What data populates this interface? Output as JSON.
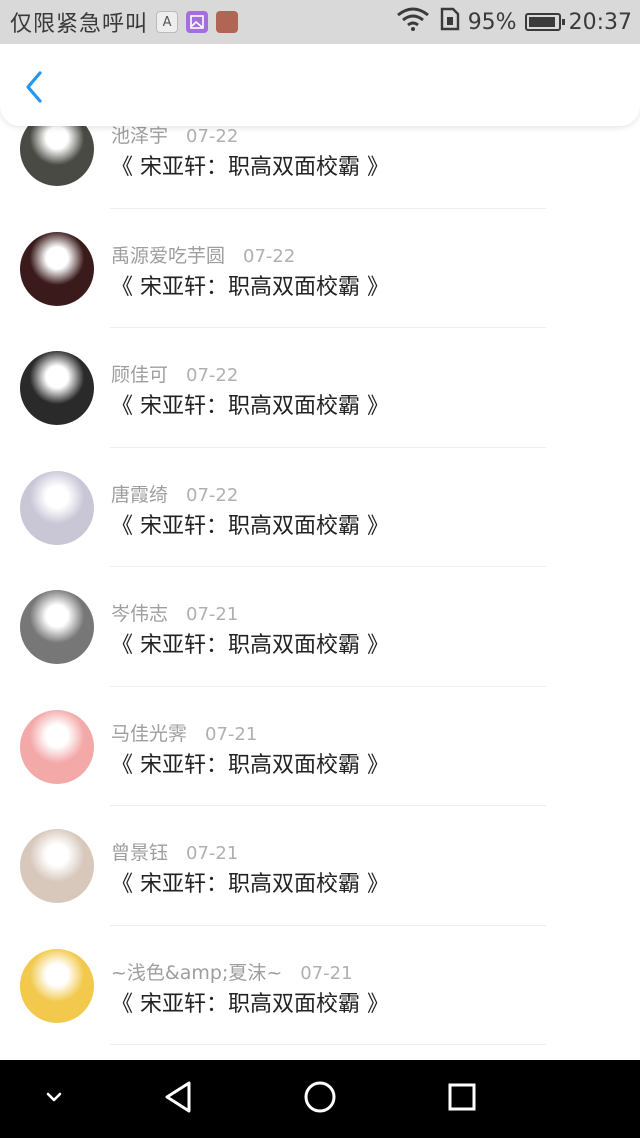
{
  "status_bar": {
    "carrier": "仅限紧急呼叫",
    "icons": [
      "a-icon",
      "photo-icon",
      "app-icon",
      "wifi-icon",
      "sim-icon",
      "battery-icon"
    ],
    "a_icon_label": "A",
    "battery": "95%",
    "time": "20:37"
  },
  "header": {
    "back_icon": "chevron-left-icon",
    "accent_color": "#2196f3"
  },
  "list": {
    "items": [
      {
        "name": "池泽宇",
        "date": "07-22",
        "title": "《 宋亚轩：职高双面校霸 》",
        "avatar_color": "#4a4a44"
      },
      {
        "name": "禹源爱吃芋圆",
        "date": "07-22",
        "title": "《 宋亚轩：职高双面校霸 》",
        "avatar_color": "#3a1a1a"
      },
      {
        "name": "顾佳可",
        "date": "07-22",
        "title": "《 宋亚轩：职高双面校霸 》",
        "avatar_color": "#2a2a2a"
      },
      {
        "name": "唐霞绮",
        "date": "07-22",
        "title": "《 宋亚轩：职高双面校霸 》",
        "avatar_color": "#c9c6d6"
      },
      {
        "name": "岑伟志",
        "date": "07-21",
        "title": "《 宋亚轩：职高双面校霸 》",
        "avatar_color": "#777777"
      },
      {
        "name": "马佳光霁",
        "date": "07-21",
        "title": "《 宋亚轩：职高双面校霸 》",
        "avatar_color": "#f4a9a9"
      },
      {
        "name": "曾景钰",
        "date": "07-21",
        "title": "《 宋亚轩：职高双面校霸 》",
        "avatar_color": "#d8c8bc"
      },
      {
        "name": "~浅色&amp;夏沫~",
        "date": "07-21",
        "title": "《 宋亚轩：职高双面校霸 》",
        "avatar_color": "#f2c94c"
      }
    ]
  },
  "nav_bar": {
    "buttons": [
      "collapse-icon",
      "back-triangle-icon",
      "home-circle-icon",
      "recents-square-icon"
    ]
  }
}
